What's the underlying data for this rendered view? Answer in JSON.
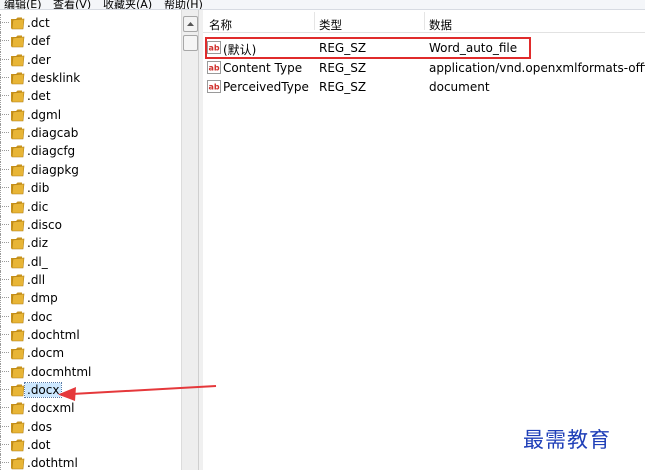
{
  "menu": {
    "items": [
      {
        "label": "编辑(E)"
      },
      {
        "label": "查看(V)"
      },
      {
        "label": "收藏夹(A)"
      },
      {
        "label": "帮助(H)"
      }
    ]
  },
  "tree": {
    "items": [
      {
        "label": ".dct"
      },
      {
        "label": ".def"
      },
      {
        "label": ".der"
      },
      {
        "label": ".desklink"
      },
      {
        "label": ".det"
      },
      {
        "label": ".dgml"
      },
      {
        "label": ".diagcab"
      },
      {
        "label": ".diagcfg"
      },
      {
        "label": ".diagpkg"
      },
      {
        "label": ".dib"
      },
      {
        "label": ".dic"
      },
      {
        "label": ".disco"
      },
      {
        "label": ".diz"
      },
      {
        "label": ".dl_"
      },
      {
        "label": ".dll"
      },
      {
        "label": ".dmp"
      },
      {
        "label": ".doc"
      },
      {
        "label": ".dochtml"
      },
      {
        "label": ".docm"
      },
      {
        "label": ".docmhtml"
      },
      {
        "label": ".docx"
      },
      {
        "label": ".docxml"
      },
      {
        "label": ".dos"
      },
      {
        "label": ".dot"
      },
      {
        "label": ".dothtml"
      }
    ],
    "selected_label": ".docx"
  },
  "values": {
    "columns": {
      "name": "名称",
      "type": "类型",
      "data": "数据"
    },
    "rows": [
      {
        "name": "(默认)",
        "type": "REG_SZ",
        "data": "Word_auto_file"
      },
      {
        "name": "Content Type",
        "type": "REG_SZ",
        "data": "application/vnd.openxmlformats-officed"
      },
      {
        "name": "PerceivedType",
        "type": "REG_SZ",
        "data": "document"
      }
    ]
  },
  "watermark": {
    "text": "最需教育"
  },
  "colors": {
    "folder": "#e8b536",
    "highlight_border": "#e02b2b",
    "arrow": "#e5383b",
    "ab_icon": "#d0302c",
    "watermark": "#1f3fb8",
    "selection": "#cde8ff"
  },
  "icons": {
    "tree": "folder-icon",
    "value": "string-value-ab-icon",
    "scroll": "scroll-up-arrow-icon"
  }
}
